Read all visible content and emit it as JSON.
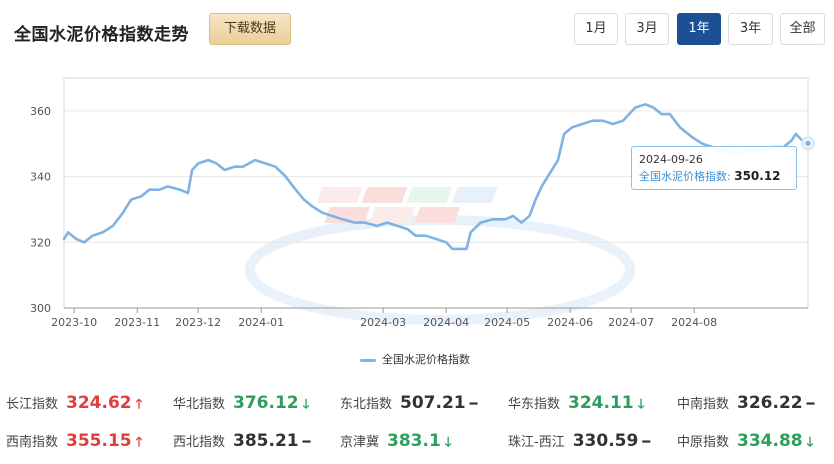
{
  "header": {
    "title": "全国水泥价格指数走势",
    "download_label": "下载数据",
    "ranges": [
      {
        "label": "1月",
        "active": false
      },
      {
        "label": "3月",
        "active": false
      },
      {
        "label": "1年",
        "active": true
      },
      {
        "label": "3年",
        "active": false
      },
      {
        "label": "全部",
        "active": false
      }
    ]
  },
  "chart_data": {
    "type": "line",
    "series": [
      {
        "name": "全国水泥价格指数",
        "color": "#7fb3e3",
        "points": [
          [
            "2023-09-26",
            321
          ],
          [
            "2023-09-28",
            323
          ],
          [
            "2023-10-02",
            321
          ],
          [
            "2023-10-06",
            320
          ],
          [
            "2023-10-10",
            322
          ],
          [
            "2023-10-15",
            323
          ],
          [
            "2023-10-20",
            325
          ],
          [
            "2023-10-25",
            329
          ],
          [
            "2023-10-29",
            333
          ],
          [
            "2023-11-03",
            334
          ],
          [
            "2023-11-07",
            336
          ],
          [
            "2023-11-12",
            336
          ],
          [
            "2023-11-16",
            337
          ],
          [
            "2023-11-22",
            336
          ],
          [
            "2023-11-26",
            335
          ],
          [
            "2023-11-28",
            342
          ],
          [
            "2023-12-01",
            344
          ],
          [
            "2023-12-06",
            345
          ],
          [
            "2023-12-10",
            344
          ],
          [
            "2023-12-14",
            342
          ],
          [
            "2023-12-19",
            343
          ],
          [
            "2023-12-23",
            343
          ],
          [
            "2023-12-29",
            345
          ],
          [
            "2024-01-03",
            344
          ],
          [
            "2024-01-08",
            343
          ],
          [
            "2024-01-13",
            340
          ],
          [
            "2024-01-18",
            336
          ],
          [
            "2024-01-22",
            333
          ],
          [
            "2024-01-26",
            331
          ],
          [
            "2024-01-31",
            329
          ],
          [
            "2024-02-05",
            328
          ],
          [
            "2024-02-10",
            327
          ],
          [
            "2024-02-16",
            326
          ],
          [
            "2024-02-21",
            326
          ],
          [
            "2024-02-27",
            325
          ],
          [
            "2024-03-03",
            326
          ],
          [
            "2024-03-08",
            325
          ],
          [
            "2024-03-13",
            324
          ],
          [
            "2024-03-17",
            322
          ],
          [
            "2024-03-22",
            322
          ],
          [
            "2024-03-27",
            321
          ],
          [
            "2024-04-01",
            320
          ],
          [
            "2024-04-04",
            318
          ],
          [
            "2024-04-08",
            318
          ],
          [
            "2024-04-11",
            318
          ],
          [
            "2024-04-13",
            323
          ],
          [
            "2024-04-18",
            326
          ],
          [
            "2024-04-24",
            327
          ],
          [
            "2024-04-30",
            327
          ],
          [
            "2024-05-04",
            328
          ],
          [
            "2024-05-08",
            326
          ],
          [
            "2024-05-12",
            328
          ],
          [
            "2024-05-15",
            333
          ],
          [
            "2024-05-18",
            337
          ],
          [
            "2024-05-22",
            341
          ],
          [
            "2024-05-26",
            345
          ],
          [
            "2024-05-29",
            353
          ],
          [
            "2024-06-02",
            355
          ],
          [
            "2024-06-07",
            356
          ],
          [
            "2024-06-12",
            357
          ],
          [
            "2024-06-17",
            357
          ],
          [
            "2024-06-22",
            356
          ],
          [
            "2024-06-27",
            357
          ],
          [
            "2024-07-03",
            361
          ],
          [
            "2024-07-08",
            362
          ],
          [
            "2024-07-12",
            361
          ],
          [
            "2024-07-16",
            359
          ],
          [
            "2024-07-20",
            359
          ],
          [
            "2024-07-25",
            355
          ],
          [
            "2024-07-31",
            352
          ],
          [
            "2024-08-05",
            350
          ],
          [
            "2024-08-10",
            349
          ],
          [
            "2024-08-16",
            348
          ],
          [
            "2024-08-22",
            347
          ],
          [
            "2024-08-28",
            348
          ],
          [
            "2024-09-03",
            348
          ],
          [
            "2024-09-09",
            349
          ],
          [
            "2024-09-14",
            349
          ],
          [
            "2024-09-18",
            351
          ],
          [
            "2024-09-20",
            353
          ],
          [
            "2024-09-23",
            351
          ],
          [
            "2024-09-26",
            350.12
          ]
        ]
      }
    ],
    "x_tick_labels": [
      "2023-10",
      "2023-11",
      "2023-12",
      "2024-01",
      "2024-03",
      "2024-04",
      "2024-05",
      "2024-06",
      "2024-07",
      "2024-08"
    ],
    "y_ticks": [
      300,
      320,
      340,
      360
    ],
    "ylim": [
      300,
      370
    ],
    "xlim": [
      "2023-09-26",
      "2024-09-26"
    ],
    "grid": "horizontal",
    "legend_position": "bottom-center",
    "tooltip": {
      "date": "2024-09-26",
      "series_name": "全国水泥价格指数",
      "value": "350.12"
    }
  },
  "tooltip": {
    "date": "2024-09-26",
    "series_label": "全国水泥价格指数:",
    "value": "350.12"
  },
  "legend": {
    "label": "全国水泥价格指数"
  },
  "indices": [
    [
      {
        "name": "长江指数",
        "value": "324.62",
        "trend": "up"
      },
      {
        "name": "华北指数",
        "value": "376.12",
        "trend": "down"
      },
      {
        "name": "东北指数",
        "value": "507.21",
        "trend": "flat"
      },
      {
        "name": "华东指数",
        "value": "324.11",
        "trend": "down"
      },
      {
        "name": "中南指数",
        "value": "326.22",
        "trend": "flat"
      }
    ],
    [
      {
        "name": "西南指数",
        "value": "355.15",
        "trend": "up"
      },
      {
        "name": "西北指数",
        "value": "385.21",
        "trend": "flat"
      },
      {
        "name": "京津冀",
        "value": "383.1",
        "trend": "down"
      },
      {
        "name": "珠江-西江",
        "value": "330.59",
        "trend": "flat"
      },
      {
        "name": "中原指数",
        "value": "334.88",
        "trend": "down"
      }
    ]
  ],
  "colors": {
    "up": "#e23d3d",
    "down": "#2e9e5b",
    "flat": "#333333",
    "accent": "#1d4f94",
    "line": "#7fb3e3"
  }
}
